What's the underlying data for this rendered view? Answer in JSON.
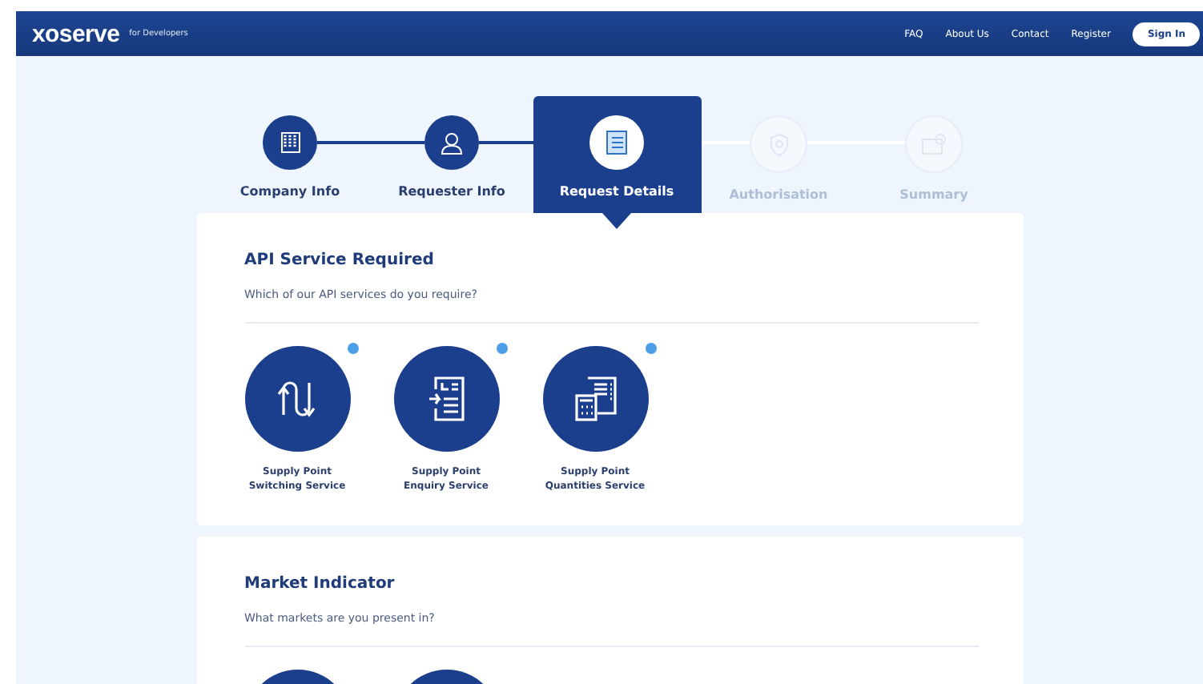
{
  "header": {
    "logo": "xoserve",
    "tagline": "for Developers",
    "nav": [
      "FAQ",
      "About Us",
      "Contact",
      "Register"
    ],
    "sign_in": "Sign In"
  },
  "steps": [
    {
      "label": "Company Info",
      "kind": "done",
      "selected": false
    },
    {
      "label": "Requester Info",
      "kind": "done",
      "selected": false
    },
    {
      "label": "Request Details",
      "kind": "current",
      "selected": true
    },
    {
      "label": "Authorisation",
      "kind": "upcoming",
      "selected": false
    },
    {
      "label": "Summary",
      "kind": "upcoming",
      "selected": false
    }
  ],
  "sections": [
    {
      "title": "API Service Required",
      "question": "Which of our API services do you require?",
      "options": [
        {
          "kind": "switching",
          "line1": "Supply Point",
          "line2": "Switching Service"
        },
        {
          "kind": "enquiry",
          "line1": "Supply Point",
          "line2": "Enquiry Service"
        },
        {
          "kind": "quantities",
          "line1": "Supply Point",
          "line2": "Quantities Service"
        }
      ]
    },
    {
      "title": "Market Indicator",
      "question": "What markets are you present in?",
      "options": [
        {
          "kind": "blank"
        },
        {
          "kind": "blank"
        }
      ]
    }
  ]
}
